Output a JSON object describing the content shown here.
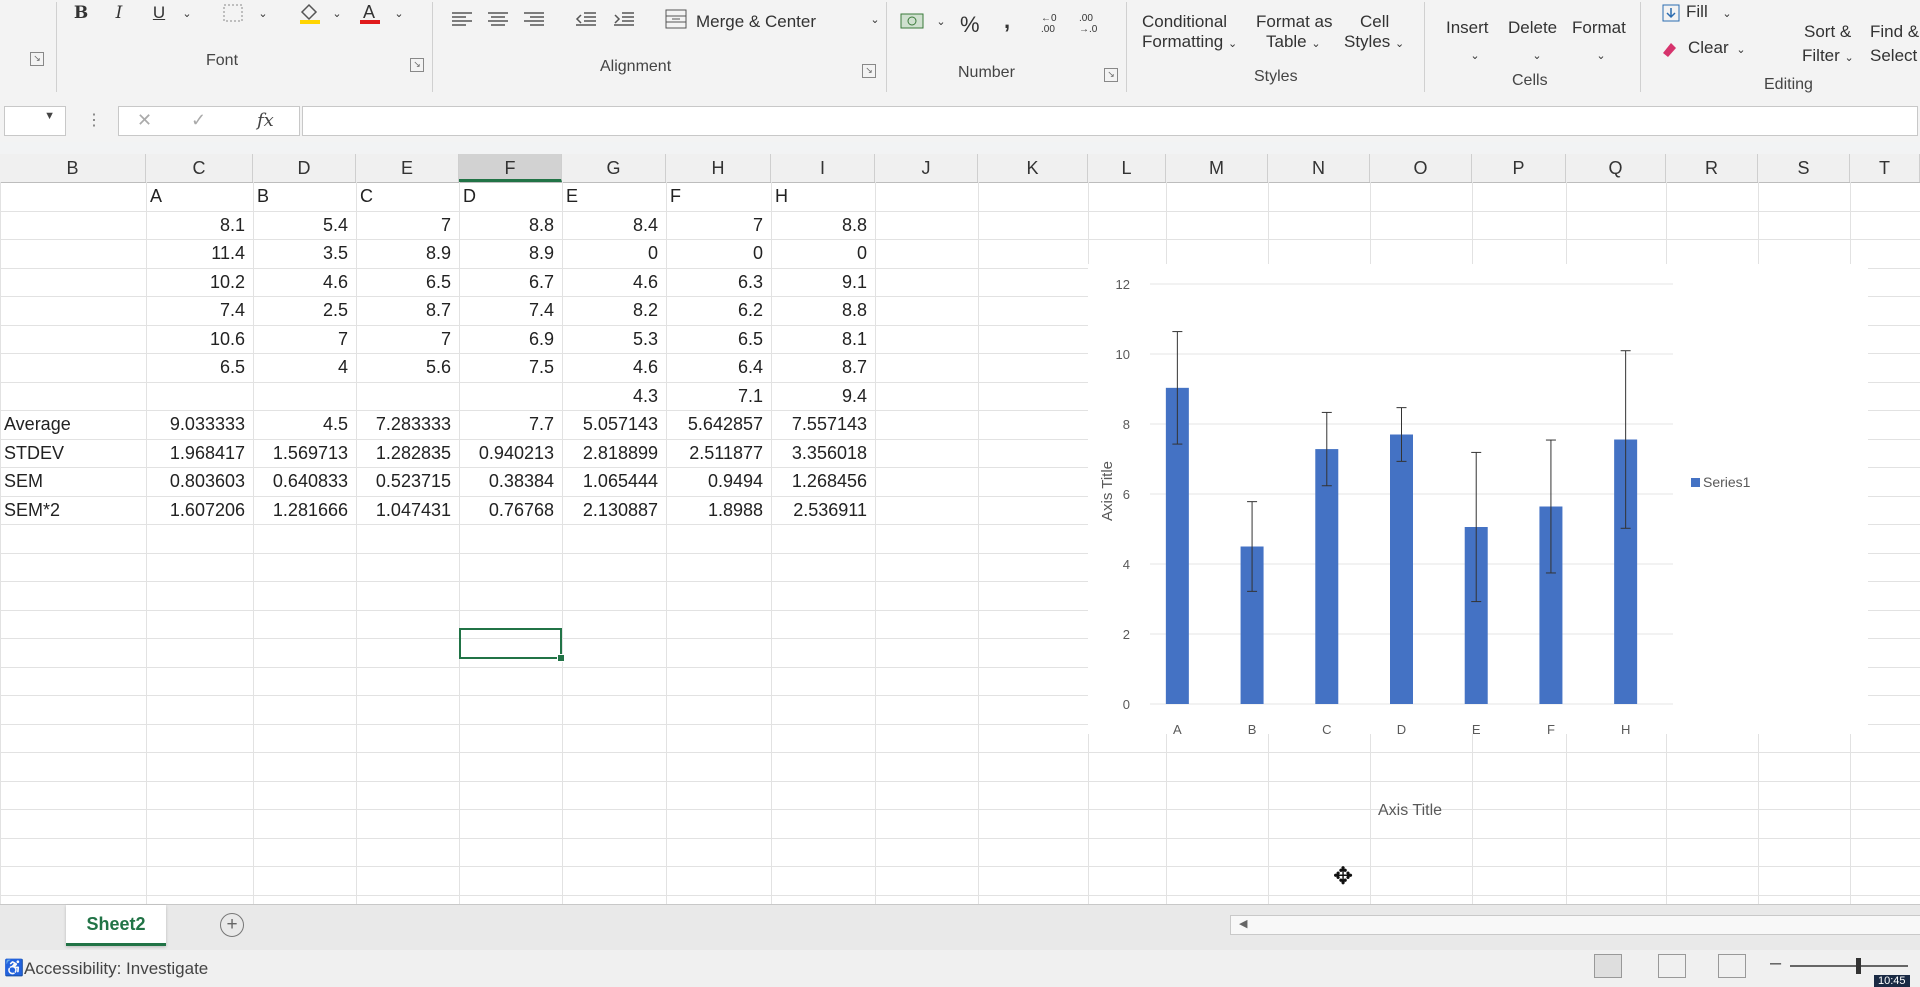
{
  "ribbon": {
    "bold": "B",
    "italic": "I",
    "underline": "U",
    "font_group": "Font",
    "alignment_group": "Alignment",
    "merge_center": "Merge & Center",
    "percent": "%",
    "comma": ",",
    "number_group": "Number",
    "conditional_formatting": [
      "Conditional",
      "Formatting"
    ],
    "format_as_table": [
      "Format as",
      "Table"
    ],
    "cell_styles": [
      "Cell",
      "Styles"
    ],
    "styles_group": "Styles",
    "insert": "Insert",
    "delete": "Delete",
    "format": "Format",
    "cells_group": "Cells",
    "fill": "Fill",
    "clear": "Clear",
    "sort_filter": [
      "Sort &",
      "Filter"
    ],
    "find_select": [
      "Find &",
      "Select"
    ],
    "editing_group": "Editing"
  },
  "formula_bar": {
    "cancel": "✕",
    "enter": "✓",
    "fx": "fx",
    "value": ""
  },
  "sheet": {
    "columns": [
      "B",
      "C",
      "D",
      "E",
      "F",
      "G",
      "H",
      "I",
      "J",
      "K",
      "L",
      "M",
      "N",
      "O",
      "P",
      "Q",
      "R",
      "S",
      "T"
    ],
    "selected_column": "F",
    "header_row": [
      "A",
      "B",
      "C",
      "D",
      "E",
      "F",
      "H"
    ],
    "data_rows": [
      [
        "8.1",
        "5.4",
        "7",
        "8.8",
        "8.4",
        "7",
        "8.8"
      ],
      [
        "11.4",
        "3.5",
        "8.9",
        "8.9",
        "0",
        "0",
        "0"
      ],
      [
        "10.2",
        "4.6",
        "6.5",
        "6.7",
        "4.6",
        "6.3",
        "9.1"
      ],
      [
        "7.4",
        "2.5",
        "8.7",
        "7.4",
        "8.2",
        "6.2",
        "8.8"
      ],
      [
        "10.6",
        "7",
        "7",
        "6.9",
        "5.3",
        "6.5",
        "8.1"
      ],
      [
        "6.5",
        "4",
        "5.6",
        "7.5",
        "4.6",
        "6.4",
        "8.7"
      ],
      [
        "",
        "",
        "",
        "",
        "4.3",
        "7.1",
        "9.4"
      ]
    ],
    "stats": [
      {
        "label": "Average",
        "values": [
          "9.033333",
          "4.5",
          "7.283333",
          "7.7",
          "5.057143",
          "5.642857",
          "7.557143"
        ]
      },
      {
        "label": "STDEV",
        "values": [
          "1.968417",
          "1.569713",
          "1.282835",
          "0.940213",
          "2.818899",
          "2.511877",
          "3.356018"
        ]
      },
      {
        "label": "SEM",
        "values": [
          "0.803603",
          "0.640833",
          "0.523715",
          "0.38384",
          "1.065444",
          "0.9494",
          "1.268456"
        ]
      },
      {
        "label": "SEM*2",
        "values": [
          "1.607206",
          "1.281666",
          "1.047431",
          "0.76768",
          "2.130887",
          "1.8988",
          "2.536911"
        ]
      }
    ]
  },
  "chart_data": {
    "type": "bar",
    "categories": [
      "A",
      "B",
      "C",
      "D",
      "E",
      "F",
      "H"
    ],
    "series": [
      {
        "name": "Series1",
        "values": [
          9.033333,
          4.5,
          7.283333,
          7.7,
          5.057143,
          5.642857,
          7.557143
        ],
        "error": [
          1.607206,
          1.281666,
          1.047431,
          0.76768,
          2.130887,
          1.8988,
          2.536911
        ]
      }
    ],
    "xlabel": "Axis Title",
    "ylabel": "Axis Title",
    "ylim": [
      0,
      12
    ],
    "yticks": [
      0,
      2,
      4,
      6,
      8,
      10,
      12
    ],
    "bar_color": "#4472c4",
    "legend": "right"
  },
  "tabs": {
    "sheet_name": "Sheet2",
    "add": "+"
  },
  "status": {
    "accessibility": "Accessibility: Investigate",
    "time": "10:45"
  }
}
